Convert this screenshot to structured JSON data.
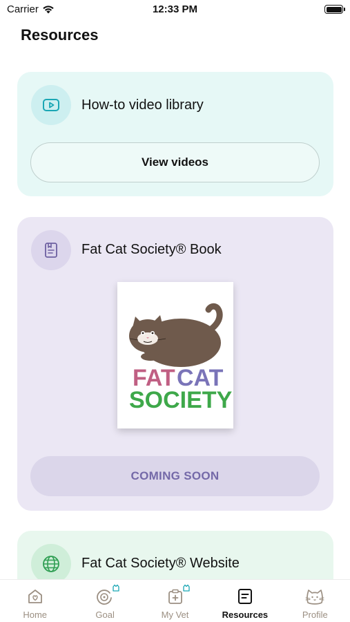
{
  "status_bar": {
    "carrier": "Carrier",
    "time": "12:33 PM"
  },
  "page": {
    "title": "Resources"
  },
  "cards": {
    "video": {
      "icon": "play-video-icon",
      "title": "How-to video library",
      "button_label": "View videos",
      "bg_color": "#e6f8f6"
    },
    "book": {
      "icon": "book-icon",
      "title": "Fat Cat Society® Book",
      "cover_title_line1_word1": "FAT",
      "cover_title_line1_word2": "CAT",
      "cover_title_line2": "SOCIETY",
      "button_label": "COMING SOON",
      "bg_color": "#ebe7f4"
    },
    "website": {
      "icon": "globe-icon",
      "title": "Fat Cat Society® Website",
      "bg_color": "#e8f7ee"
    }
  },
  "tab_bar": {
    "active": "resources",
    "tabs": [
      {
        "id": "home",
        "label": "Home",
        "icon": "home-heart-icon"
      },
      {
        "id": "goal",
        "label": "Goal",
        "icon": "goal-target-icon"
      },
      {
        "id": "my_vet",
        "label": "My Vet",
        "icon": "vet-clipboard-icon"
      },
      {
        "id": "resources",
        "label": "Resources",
        "icon": "resources-document-icon"
      },
      {
        "id": "profile",
        "label": "Profile",
        "icon": "cat-face-icon"
      }
    ]
  },
  "colors": {
    "accent_teal": "#1aa6b4",
    "accent_purple": "#7469a8",
    "accent_green": "#2e9e52",
    "tab_inactive": "#9b8f82"
  }
}
